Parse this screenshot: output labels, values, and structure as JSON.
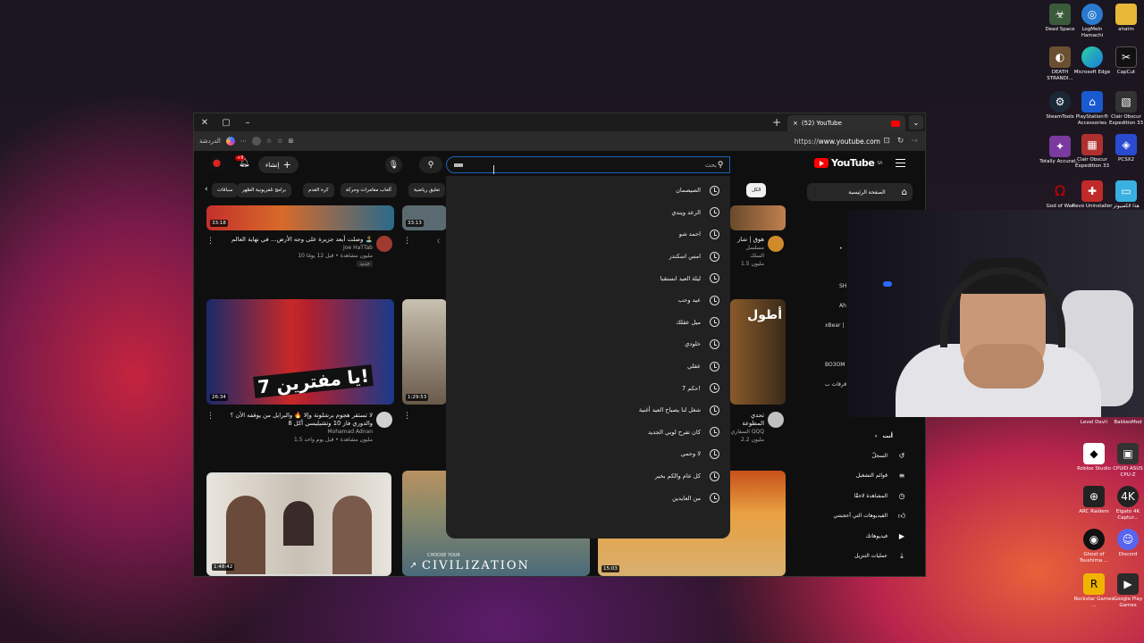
{
  "desktop": {
    "icons_col1": [
      "Dead Space",
      "DEATH STRANDI...",
      "SteamTools",
      "Totally Accurat...",
      "God of War",
      "Level Devil",
      "Roblox Studio",
      "ARC Raiders",
      "Ghost of Tsushima ...",
      "Rockstar Games ..."
    ],
    "icons_col2": [
      "LogMeIn Hamachi",
      "Microsoft Edge",
      "PlayStation® Accessories",
      "Clair Obscur Expedition 33",
      "Revo Uninstaller",
      "BakkesMod",
      "CPUID ASUS CPU-Z",
      "Elgato 4K Captur...",
      "Discord",
      "Google Play Games"
    ],
    "icons_col3": [
      "ahatm",
      "CapCut",
      "Clair Obscur Expedition 33",
      "PCSX2",
      "هذا الكمبيوتر"
    ]
  },
  "browser": {
    "tab_title": "(52) YouTube",
    "url_prefix": "https://",
    "url_host": "www.youtube.com",
    "copilot_label": "الدردشة",
    "new_tab": "+",
    "tab_close": "×"
  },
  "youtube": {
    "logo": "YouTube",
    "region": "SA",
    "search_placeholder": "بحث",
    "create_label": "إنشاء",
    "notif_count": "+9",
    "chips": [
      {
        "label": "الكل",
        "active": true
      },
      {
        "label": "سباقات",
        "active": false
      },
      {
        "label": "برامج تلفزيونية الظهر",
        "active": false
      },
      {
        "label": "كرة القدم",
        "active": false
      },
      {
        "label": "ألعاب مغامرات وحركة",
        "active": false
      },
      {
        "label": "تعليق رياضية",
        "active": false
      }
    ],
    "sidebar": {
      "home": "الصفحة الرئيسية",
      "you": "أنت",
      "items": [
        "السجلّ",
        "قوائم التشغيل",
        "المشاهدة لاحقًا",
        "الفيديوهات التي أعجبتني",
        "فيديوهاتك",
        "عمليات التنزيل"
      ],
      "fragments": [
        "SH",
        "Ah",
        "xBear |",
        "BO3OM",
        "قرقات ب"
      ]
    },
    "suggestions": [
      "الصيصمان",
      "الرعد ويندي",
      "احمد شو",
      "امس اسكندر",
      "ليلة العيد انستقبا",
      "عيد وحب",
      "ميل عقلك",
      "خلودي",
      "عقلي",
      "حكم 7!",
      "شغل لنا يصباح العيد أغنية",
      "كان تفرح لوبي الجديد",
      "لا وحمي",
      "كل عام والكم بخير",
      "من العايدين"
    ],
    "videos": [
      {
        "duration": "33:18",
        "title": "وصلت أبعد جزيرة على وجه الأرض... في نهاية العالم 🏝️",
        "channel": "Joe HaTTab",
        "meta": "10 مليون مشاهدة • قبل 12 يومًا",
        "badge": "جديد"
      },
      {
        "duration": "33:13",
        "title": "",
        "channel": "",
        "meta": "",
        "badge": ""
      },
      {
        "duration": "",
        "title": "هوق | شار",
        "channel": "مسلسل السلك",
        "meta": "1.5 مليون",
        "badge": ""
      },
      {
        "duration": "26:34",
        "title": "لا تستقر هجوم برشلونة وإلا 🔥 والبرايل من يوقفه الأن ؟ والدوري فاز 10 وتشيليسي أكل 8",
        "channel": "Mohamad Adnan",
        "meta": "1.5 مليون مشاهدة • قبل يوم واحد",
        "overlay": "7 يا مفترين!"
      },
      {
        "duration": "1:29:53",
        "title": "",
        "channel": "",
        "meta": "",
        "badge": ""
      },
      {
        "duration": "",
        "title": "تحدي المطوعة",
        "channel": "السفاري QQQ",
        "meta": "2.2 مليون",
        "overlay": "أطول"
      },
      {
        "duration": "1:48:42",
        "title": "",
        "channel": "",
        "meta": ""
      },
      {
        "duration": "",
        "title": "",
        "channel": "",
        "meta": "",
        "overlay": "CIVILIZATION",
        "overlay_small": "CHOOSE YOUR"
      },
      {
        "duration": "15:03",
        "title": "",
        "channel": "",
        "meta": ""
      }
    ]
  },
  "colors": {
    "yt_red": "#ff0000",
    "accent_blue": "#1c62b9",
    "dropdown_bg": "#212121"
  }
}
